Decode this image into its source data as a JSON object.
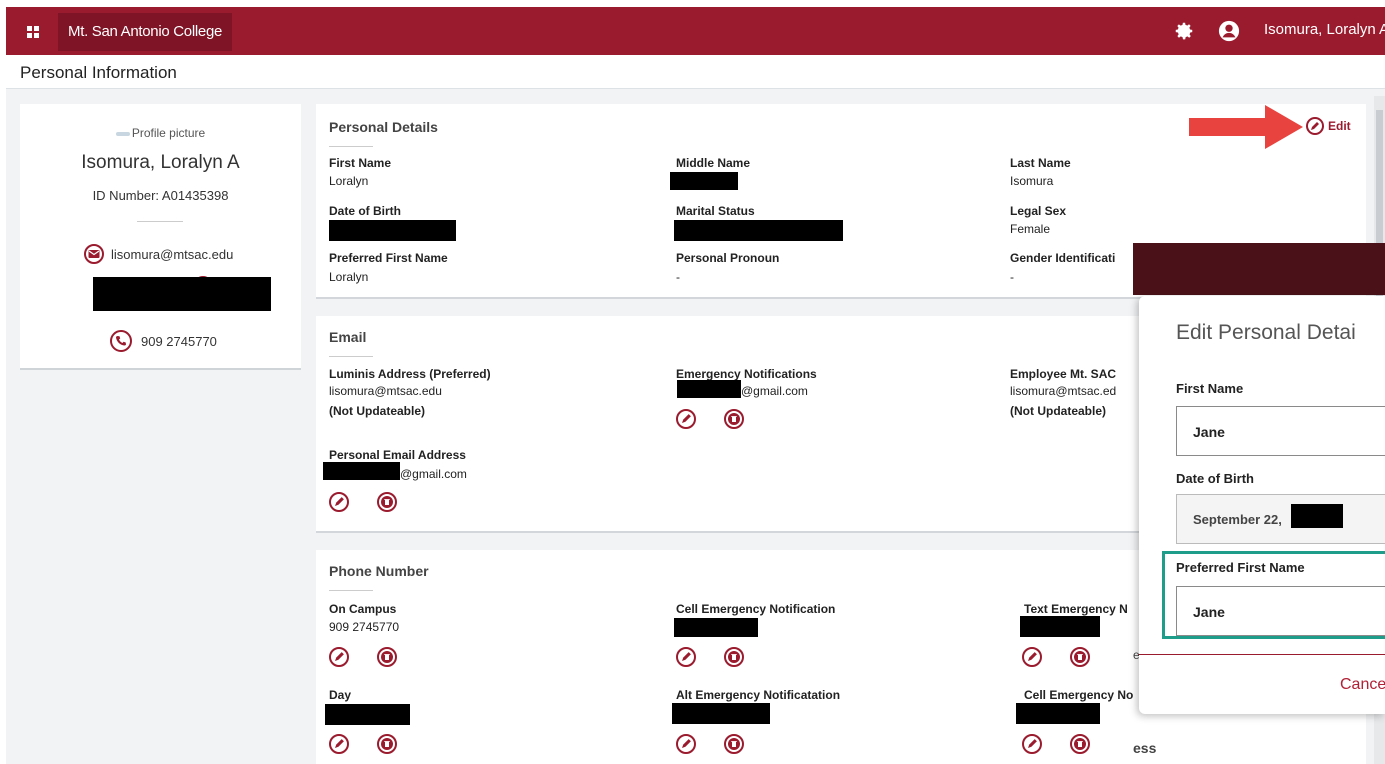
{
  "app": {
    "brand": "Mt. San Antonio College",
    "user_name": "Isomura, Loralyn A",
    "page_title": "Personal Information"
  },
  "profile": {
    "picture_alt": "Profile picture",
    "name": "Isomura, Loralyn A",
    "id_number": "ID Number: A01435398",
    "email": "lisomura@mtsac.edu",
    "phone": "909 2745770"
  },
  "personal_details": {
    "title": "Personal Details",
    "edit_label": "Edit",
    "first_name_label": "First Name",
    "first_name": "Loralyn",
    "middle_name_label": "Middle Name",
    "last_name_label": "Last Name",
    "last_name": "Isomura",
    "dob_label": "Date of Birth",
    "marital_label": "Marital Status",
    "legal_sex_label": "Legal Sex",
    "legal_sex": "Female",
    "preferred_label": "Preferred First Name",
    "preferred": "Loralyn",
    "pronoun_label": "Personal Pronoun",
    "pronoun": "-",
    "gender_label": "Gender Identificati",
    "gender": "-"
  },
  "email_section": {
    "title": "Email",
    "luminis_label": "Luminis Address (Preferred)",
    "luminis_value": "lisomura@mtsac.edu",
    "not_updateable": "(Not Updateable)",
    "emergency_label": "Emergency Notifications",
    "emergency_value": "@gmail.com",
    "employee_label": "Employee Mt. SAC",
    "employee_value": "lisomura@mtsac.ed",
    "employee_not_updateable": "(Not Updateable)",
    "personal_label": "Personal Email Address",
    "personal_value": "@gmail.com"
  },
  "phone_section": {
    "title": "Phone Number",
    "on_campus_label": "On Campus",
    "on_campus_value": "909 2745770",
    "cell_emergency_label": "Cell Emergency Notification",
    "text_emergency_label": "Text Emergency N",
    "day_label": "Day",
    "alt_emergency_label": "Alt Emergency Notificatation",
    "cell_emergency2_label": "Cell Emergency No"
  },
  "modal": {
    "title": "Edit Personal Detai",
    "first_name_label": "First Name",
    "first_name_value": "Jane",
    "dob_label": "Date of Birth",
    "dob_value": "September 22,",
    "preferred_label": "Preferred First Name",
    "preferred_value": "Jane",
    "cancel_label": "Cance"
  },
  "behind_text": {
    "address_fragment": "ess",
    "e_fragment": "e"
  },
  "colors": {
    "brand": "#9b1b2e",
    "modal_header": "#4a1218",
    "highlight": "#1e9e8a",
    "arrow": "#e8433e"
  }
}
